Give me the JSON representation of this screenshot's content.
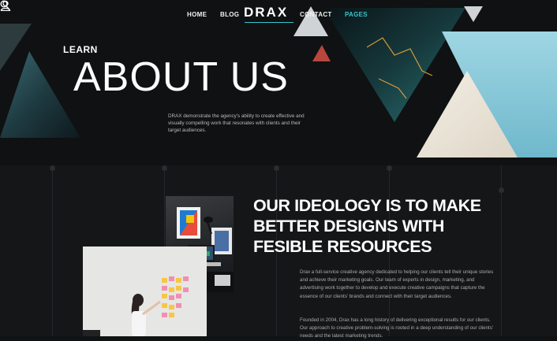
{
  "nav": {
    "links": [
      "HOME",
      "BLOG",
      "CONTACT",
      "PAGES"
    ],
    "logo": "DRAX",
    "active": "PAGES",
    "accent": "#39c5d0",
    "left_icon": "search-icon",
    "right_icon": "user-icon"
  },
  "hero": {
    "eyebrow": "LEARN",
    "title": "ABOUT US",
    "description": "DRAX demonstrate the agency's ability to create effective and visually compelling work that resonates with clients and their target audiences."
  },
  "ideology": {
    "heading_lines": [
      "OUR IDEOLOGY IS TO MAKE",
      "BETTER DESIGNS WITH",
      "FESIBLE RESOURCES"
    ],
    "paragraphs": [
      "Drax a full-service creative agency dedicated to helping our clients tell their unique stories and achieve their marketing goals. Our team of experts in design, marketing, and advertising work together to develop and execute creative campaigns that capture the essence of our clients' brands and connect with their target audiences.",
      "Founded in 2004, Drax has a long history of delivering exceptional results for our clients. Our approach to creative problem-solving is rooted in a deep understanding of our clients' needs and the latest marketing trends."
    ]
  }
}
